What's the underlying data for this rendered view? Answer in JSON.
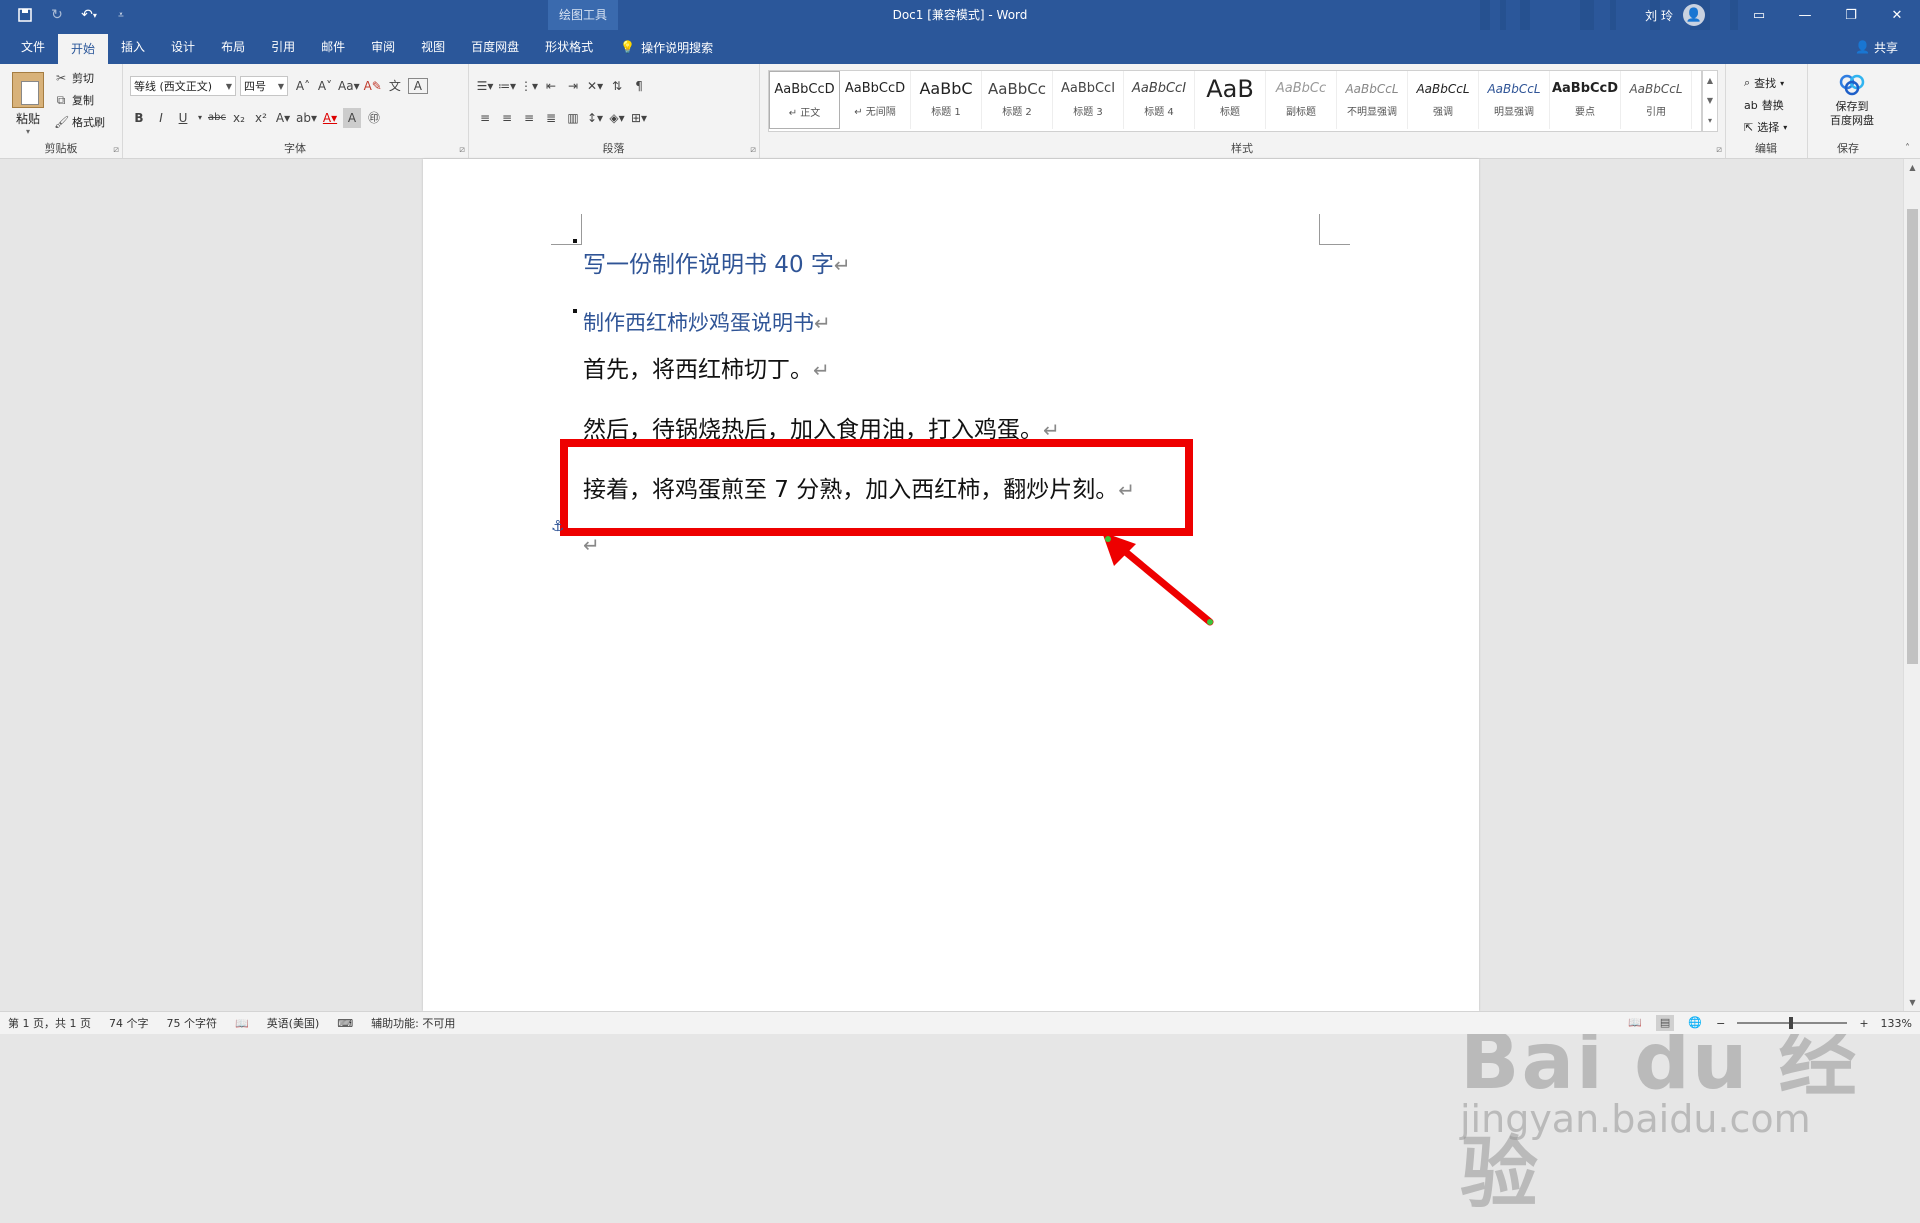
{
  "title_bar": {
    "document_title": "Doc1 [兼容模式] - Word",
    "contextual_group": "绘图工具",
    "user_name": "刘 玲"
  },
  "tabs": [
    {
      "label": "文件"
    },
    {
      "label": "开始",
      "active": true
    },
    {
      "label": "插入"
    },
    {
      "label": "设计"
    },
    {
      "label": "布局"
    },
    {
      "label": "引用"
    },
    {
      "label": "邮件"
    },
    {
      "label": "审阅"
    },
    {
      "label": "视图"
    },
    {
      "label": "百度网盘"
    },
    {
      "label": "形状格式"
    }
  ],
  "tell_me": "操作说明搜索",
  "share": "共享",
  "ribbon": {
    "clipboard": {
      "paste": "粘贴",
      "cut": "剪切",
      "copy": "复制",
      "format_painter": "格式刷",
      "label": "剪贴板"
    },
    "font": {
      "font_name": "等线 (西文正文)",
      "font_size": "四号",
      "label": "字体"
    },
    "paragraph": {
      "label": "段落"
    },
    "styles": {
      "label": "样式",
      "items": [
        {
          "sample": "AaBbCcD",
          "name": "↵ 正文"
        },
        {
          "sample": "AaBbCcD",
          "name": "↵ 无间隔"
        },
        {
          "sample": "AaBbC",
          "name": "标题 1"
        },
        {
          "sample": "AaBbCc",
          "name": "标题 2"
        },
        {
          "sample": "AaBbCcI",
          "name": "标题 3"
        },
        {
          "sample": "AaBbCcI",
          "name": "标题 4"
        },
        {
          "sample": "AaB",
          "name": "标题"
        },
        {
          "sample": "AaBbCc",
          "name": "副标题"
        },
        {
          "sample": "AaBbCcL",
          "name": "不明显强调"
        },
        {
          "sample": "AaBbCcL",
          "name": "强调"
        },
        {
          "sample": "AaBbCcL",
          "name": "明显强调"
        },
        {
          "sample": "AaBbCcD",
          "name": "要点"
        },
        {
          "sample": "AaBbCcL",
          "name": "引用"
        }
      ]
    },
    "editing": {
      "find": "查找",
      "replace": "替换",
      "select": "选择",
      "label": "编辑"
    },
    "save": {
      "button": "保存到\n百度网盘",
      "label": "保存"
    }
  },
  "document": {
    "heading1": "写一份制作说明书 40 字",
    "heading2": "制作西红柿炒鸡蛋说明书",
    "lines": [
      "首先，将西红柿切丁。",
      "然后，待锅烧热后，加入食用油，打入鸡蛋。",
      "接着，将鸡蛋煎至 7 分熟，加入西红柿，翻炒片刻。"
    ],
    "paragraph_mark": "↵"
  },
  "status_bar": {
    "page": "第 1 页，共 1 页",
    "words": "74 个字",
    "chars": "75 个字符",
    "language": "英语(美国)",
    "accessibility": "辅助功能: 不可用",
    "zoom": "133%"
  },
  "watermark": {
    "brand": "Bai du 经验",
    "url": "jingyan.baidu.com"
  },
  "colors": {
    "accent": "#2b579a",
    "heading": "#2f5496",
    "highlight": "#ee0000"
  }
}
